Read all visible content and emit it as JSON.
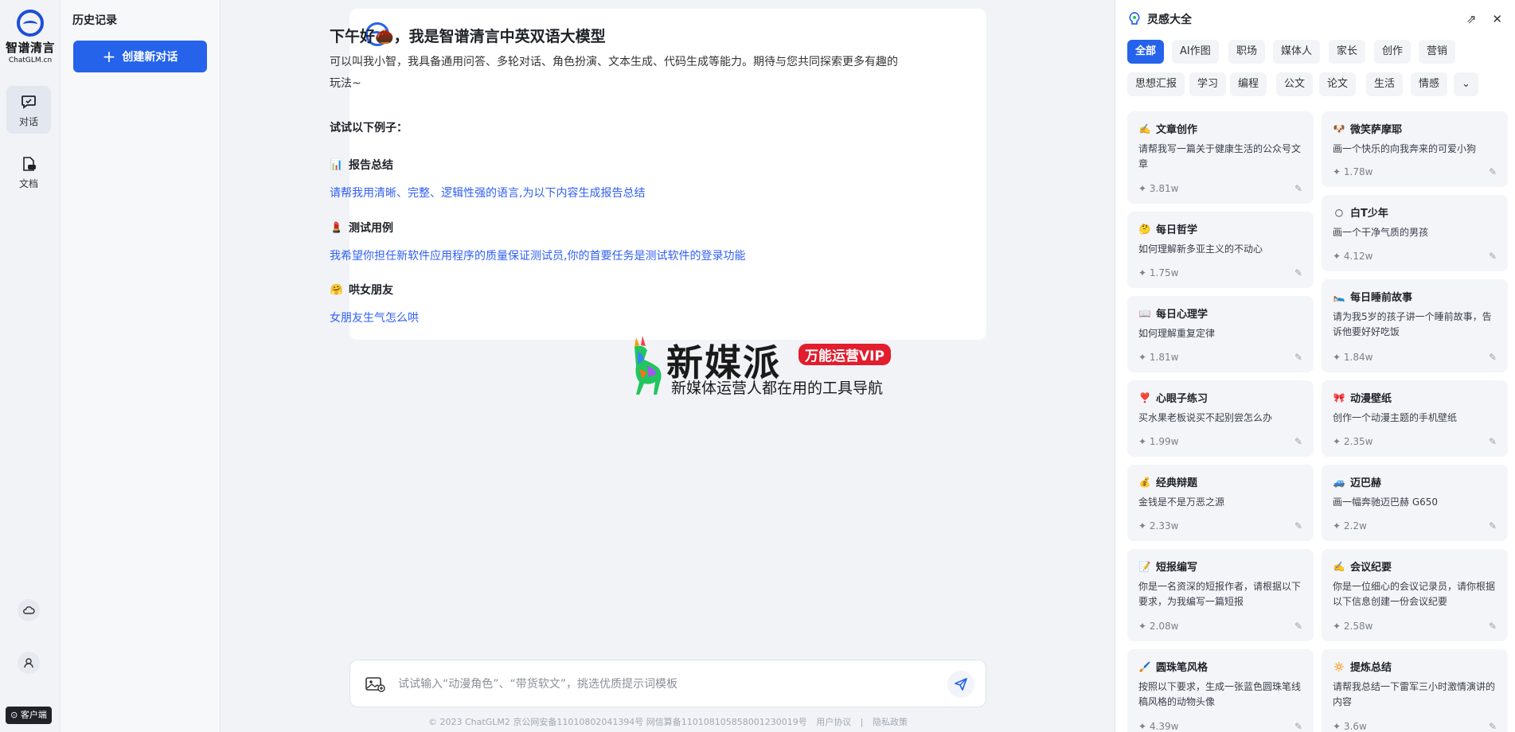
{
  "brand": {
    "logo_name": "智谱清言",
    "logo_sub": "ChatGLM.cn"
  },
  "rail": {
    "chat_label": "对话",
    "docs_label": "文档",
    "client_label": "客户端"
  },
  "history": {
    "title": "历史记录",
    "new_chat_label": "创建新对话"
  },
  "welcome": {
    "title": "下午好🌰，我是智谱清言中英双语大模型",
    "desc": "可以叫我小智，我具备通用问答、多轮对话、角色扮演、文本生成、代码生成等能力。期待与您共同探索更多有趣的玩法~",
    "try_title": "试试以下例子：",
    "examples": [
      {
        "emoji": "📊",
        "title": "报告总结",
        "text": "请帮我用清晰、完整、逻辑性强的语言,为以下内容生成报告总结"
      },
      {
        "emoji": "💄",
        "title": "测试用例",
        "text": "我希望你担任新软件应用程序的质量保证测试员,你的首要任务是测试软件的登录功能"
      },
      {
        "emoji": "🤗",
        "title": "哄女朋友",
        "text": "女朋友生气怎么哄"
      }
    ]
  },
  "watermark": {
    "name": "新媒派",
    "vip": "万能运营VIP",
    "tagline": "新媒体运营人都在用的工具导航"
  },
  "input": {
    "placeholder": "试试输入“动漫角色”、“带货软文”，挑选优质提示词模板"
  },
  "footer": {
    "copyright": "© 2023 ChatGLM2 京公网安备11010802041394号 网信算备110108105858001230019号",
    "terms": "用户协议",
    "sep": "|",
    "privacy": "隐私政策"
  },
  "inspire": {
    "title": "灵感大全",
    "tags": [
      "全部",
      "AI作图",
      "职场",
      "媒体人",
      "家长",
      "创作",
      "营销",
      "思想汇报",
      "学习",
      "编程",
      "公文",
      "论文",
      "生活",
      "情感"
    ],
    "active_tag": "全部",
    "cards": [
      {
        "emoji": "✍️",
        "title": "文章创作",
        "desc": "请帮我写一篇关于健康生活的公众号文章",
        "count": "3.81w"
      },
      {
        "emoji": "🐶",
        "title": "微笑萨摩耶",
        "desc": "画一个快乐的向我奔来的可爱小狗",
        "count": "1.78w"
      },
      {
        "emoji": "🤔",
        "title": "每日哲学",
        "desc": "如何理解新多亚主义的不动心",
        "count": "1.75w"
      },
      {
        "emoji": "○",
        "title": "白T少年",
        "desc": "画一个干净气质的男孩",
        "count": "4.12w"
      },
      {
        "emoji": "📖",
        "title": "每日心理学",
        "desc": "如何理解重复定律",
        "count": "1.81w"
      },
      {
        "emoji": "🛌",
        "title": "每日睡前故事",
        "desc": "请为我5岁的孩子讲一个睡前故事，告诉他要好好吃饭",
        "count": "1.84w"
      },
      {
        "emoji": "❣️",
        "title": "心眼子练习",
        "desc": "买水果老板说买不起别尝怎么办",
        "count": "1.99w"
      },
      {
        "emoji": "🎀",
        "title": "动漫壁纸",
        "desc": "创作一个动漫主题的手机壁纸",
        "count": "2.35w"
      },
      {
        "emoji": "💰",
        "title": "经典辩题",
        "desc": "金钱是不是万恶之源",
        "count": "2.33w"
      },
      {
        "emoji": "🚙",
        "title": "迈巴赫",
        "desc": "画一幅奔驰迈巴赫 G650",
        "count": "2.2w"
      },
      {
        "emoji": "📝",
        "title": "短报编写",
        "desc": "你是一名资深的短报作者，请根据以下要求，为我编写一篇短报",
        "count": "2.08w"
      },
      {
        "emoji": "✍️",
        "title": "会议纪要",
        "desc": "你是一位细心的会议记录员，请你根据以下信息创建一份会议纪要",
        "count": "2.58w"
      },
      {
        "emoji": "🖌️",
        "title": "圆珠笔风格",
        "desc": "按照以下要求，生成一张蓝色圆珠笔线稿风格的动物头像",
        "count": "4.39w"
      },
      {
        "emoji": "🔅",
        "title": "提炼总结",
        "desc": "请帮我总结一下雷军三小时激情演讲的内容",
        "count": "3.6w"
      }
    ]
  }
}
